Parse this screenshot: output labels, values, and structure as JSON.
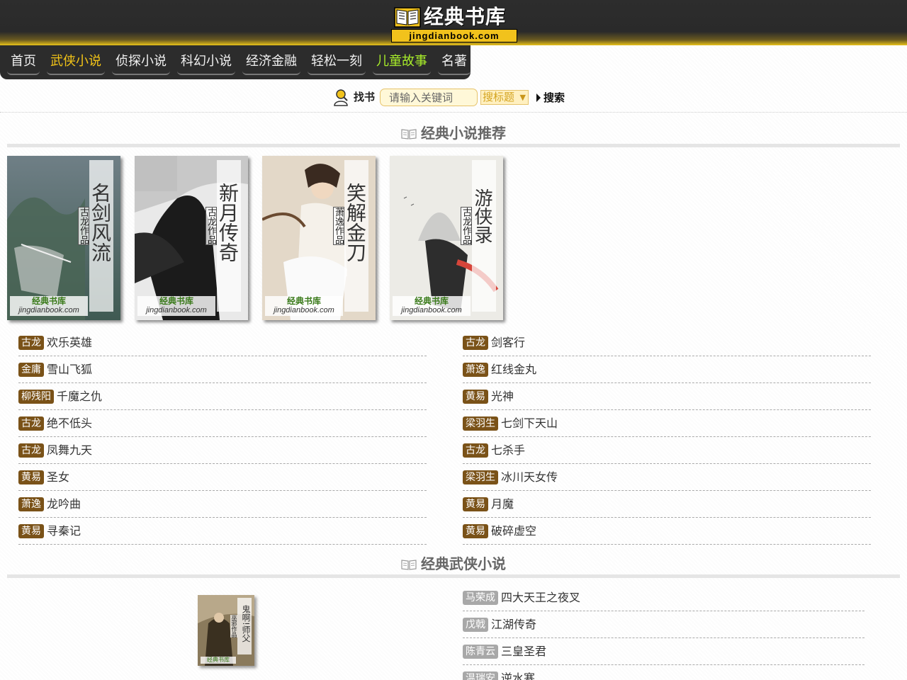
{
  "header": {
    "logo_title": "经典书库",
    "logo_url": "jingdianbook.com"
  },
  "nav": {
    "items": [
      {
        "label": "首页"
      },
      {
        "label": "武侠小说"
      },
      {
        "label": "侦探小说"
      },
      {
        "label": "科幻小说"
      },
      {
        "label": "经济金融"
      },
      {
        "label": "轻松一刻"
      },
      {
        "label": "儿童故事"
      },
      {
        "label": "名著"
      }
    ]
  },
  "search": {
    "label": "找书",
    "placeholder": "请输入关键词",
    "select_value": "搜标题",
    "button_label": "搜索"
  },
  "sections": {
    "recommend_title": "经典小说推荐",
    "wuxia_title": "经典武侠小说"
  },
  "covers": [
    {
      "title": "名剑风流",
      "author": "古龙作品",
      "logo_cn": "经典书库",
      "logo_en": "jingdianbook.com"
    },
    {
      "title": "新月传奇",
      "author": "古龙作品",
      "logo_cn": "经典书库",
      "logo_en": "jingdianbook.com"
    },
    {
      "title": "笑解金刀",
      "author": "萧逸作品",
      "logo_cn": "经典书库",
      "logo_en": "jingdianbook.com"
    },
    {
      "title": "游侠录",
      "author": "古龙作品",
      "logo_cn": "经典书库",
      "logo_en": "jingdianbook.com"
    }
  ],
  "recommend_left": [
    {
      "author": "古龙",
      "title": "欢乐英雄"
    },
    {
      "author": "金庸",
      "title": "雪山飞狐"
    },
    {
      "author": "柳残阳",
      "title": "千魔之仇"
    },
    {
      "author": "古龙",
      "title": "绝不低头"
    },
    {
      "author": "古龙",
      "title": "凤舞九天"
    },
    {
      "author": "黄易",
      "title": "圣女"
    },
    {
      "author": "萧逸",
      "title": "龙吟曲"
    },
    {
      "author": "黄易",
      "title": "寻秦记"
    }
  ],
  "recommend_right": [
    {
      "author": "古龙",
      "title": "剑客行"
    },
    {
      "author": "萧逸",
      "title": "红线金丸"
    },
    {
      "author": "黄易",
      "title": "光神"
    },
    {
      "author": "梁羽生",
      "title": "七剑下天山"
    },
    {
      "author": "古龙",
      "title": "七杀手"
    },
    {
      "author": "梁羽生",
      "title": "冰川天女传"
    },
    {
      "author": "黄易",
      "title": "月魔"
    },
    {
      "author": "黄易",
      "title": "破碎虚空"
    }
  ],
  "wuxia_cover": {
    "title": "鬼啊!师父",
    "author": "巫邪作品",
    "logo_cn": "经典书库"
  },
  "wuxia_right": [
    {
      "author": "马荣成",
      "title": "四大天王之夜叉"
    },
    {
      "author": "戊戟",
      "title": "江湖传奇"
    },
    {
      "author": "陈青云",
      "title": "三皇圣君"
    },
    {
      "author": "温瑞安",
      "title": "逆水寒"
    }
  ],
  "colors": {
    "header_bg": "#2a2a2a",
    "accent_gold": "#f1c21c",
    "nav_active": "#f3c417",
    "nav_green": "#a8ed2a",
    "author_badge": "#7a5218",
    "author_badge_gray": "#a8a8a8"
  }
}
